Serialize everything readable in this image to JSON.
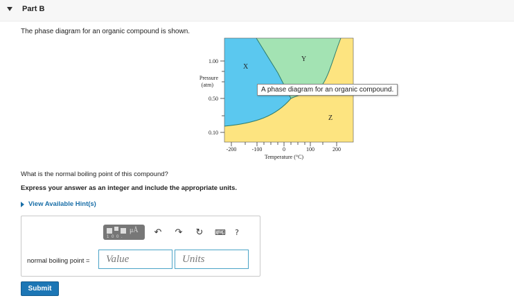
{
  "part": {
    "title": "Part B"
  },
  "intro": "The phase diagram for an organic compound is shown.",
  "diagram": {
    "y_label_line1": "Pressure",
    "y_label_line2": "(atm)",
    "x_label": "Temperature (°C)",
    "y_ticks": [
      "1.00",
      "0.50",
      "0.10"
    ],
    "x_ticks": [
      "-200",
      "-100",
      "0",
      "100",
      "200"
    ],
    "regions": {
      "x": "X",
      "y": "Y",
      "z": "Z"
    },
    "tooltip": "A phase diagram for an organic compound.",
    "colors": {
      "x_region": "#5bc8ef",
      "y_region": "#a3e3b3",
      "z_region": "#fde480",
      "boundary": "#2e7d6e"
    }
  },
  "question": "What is the normal boiling point of this compound?",
  "instructions": "Express your answer as an integer and include the appropriate units.",
  "hints_label": "View Available Hint(s)",
  "toolbar": {
    "template_icon": "templates-icon",
    "template_mu": "μÅ",
    "template_fragment": "1 0 0 .",
    "undo_icon": "undo-arrow-icon",
    "redo_icon": "redo-arrow-icon",
    "reset_icon": "reset-icon",
    "keyboard_icon": "keyboard-icon",
    "help_label": "?"
  },
  "answer": {
    "label": "normal boiling point =",
    "value_placeholder": "Value",
    "units_placeholder": "Units"
  },
  "submit_label": "Submit"
}
